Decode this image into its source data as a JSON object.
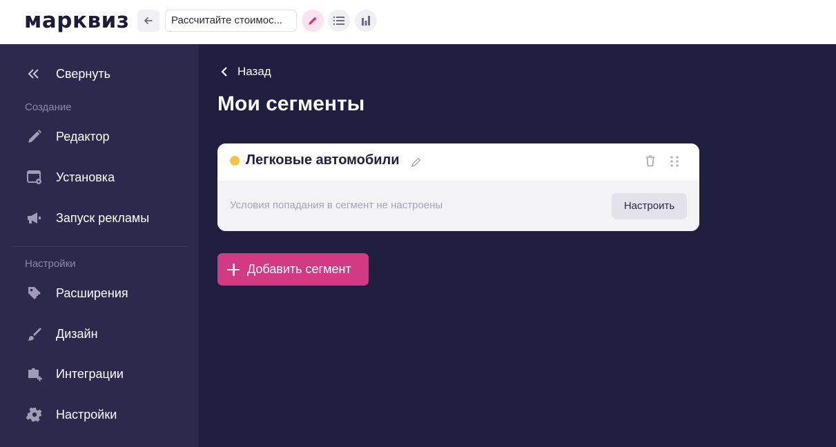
{
  "header": {
    "logo": "марквиз",
    "quiz_title": "Рассчитайте стоимос..."
  },
  "sidebar": {
    "collapse_label": "Свернуть",
    "section_create": "Создание",
    "section_settings": "Настройки",
    "items": [
      {
        "label": "Редактор",
        "icon": "pencil-icon"
      },
      {
        "label": "Установка",
        "icon": "install-window-icon"
      },
      {
        "label": "Запуск рекламы",
        "icon": "megaphone-icon"
      },
      {
        "label": "Расширения",
        "icon": "tag-plus-icon"
      },
      {
        "label": "Дизайн",
        "icon": "brush-icon"
      },
      {
        "label": "Интеграции",
        "icon": "puzzle-plus-icon"
      },
      {
        "label": "Настройки",
        "icon": "gear-icon"
      }
    ]
  },
  "main": {
    "back_label": "Назад",
    "title": "Мои сегменты",
    "segment": {
      "name": "Легковые автомобили",
      "dot_color": "#f5c43c",
      "conditions_text": "Условия попадания в сегмент не настроены",
      "setup_label": "Настроить"
    },
    "add_segment_label": "Добавить сегмент"
  },
  "colors": {
    "accent": "#d43a83",
    "sidebar_bg": "#2b2a4c",
    "main_bg": "#1f1e3f"
  }
}
